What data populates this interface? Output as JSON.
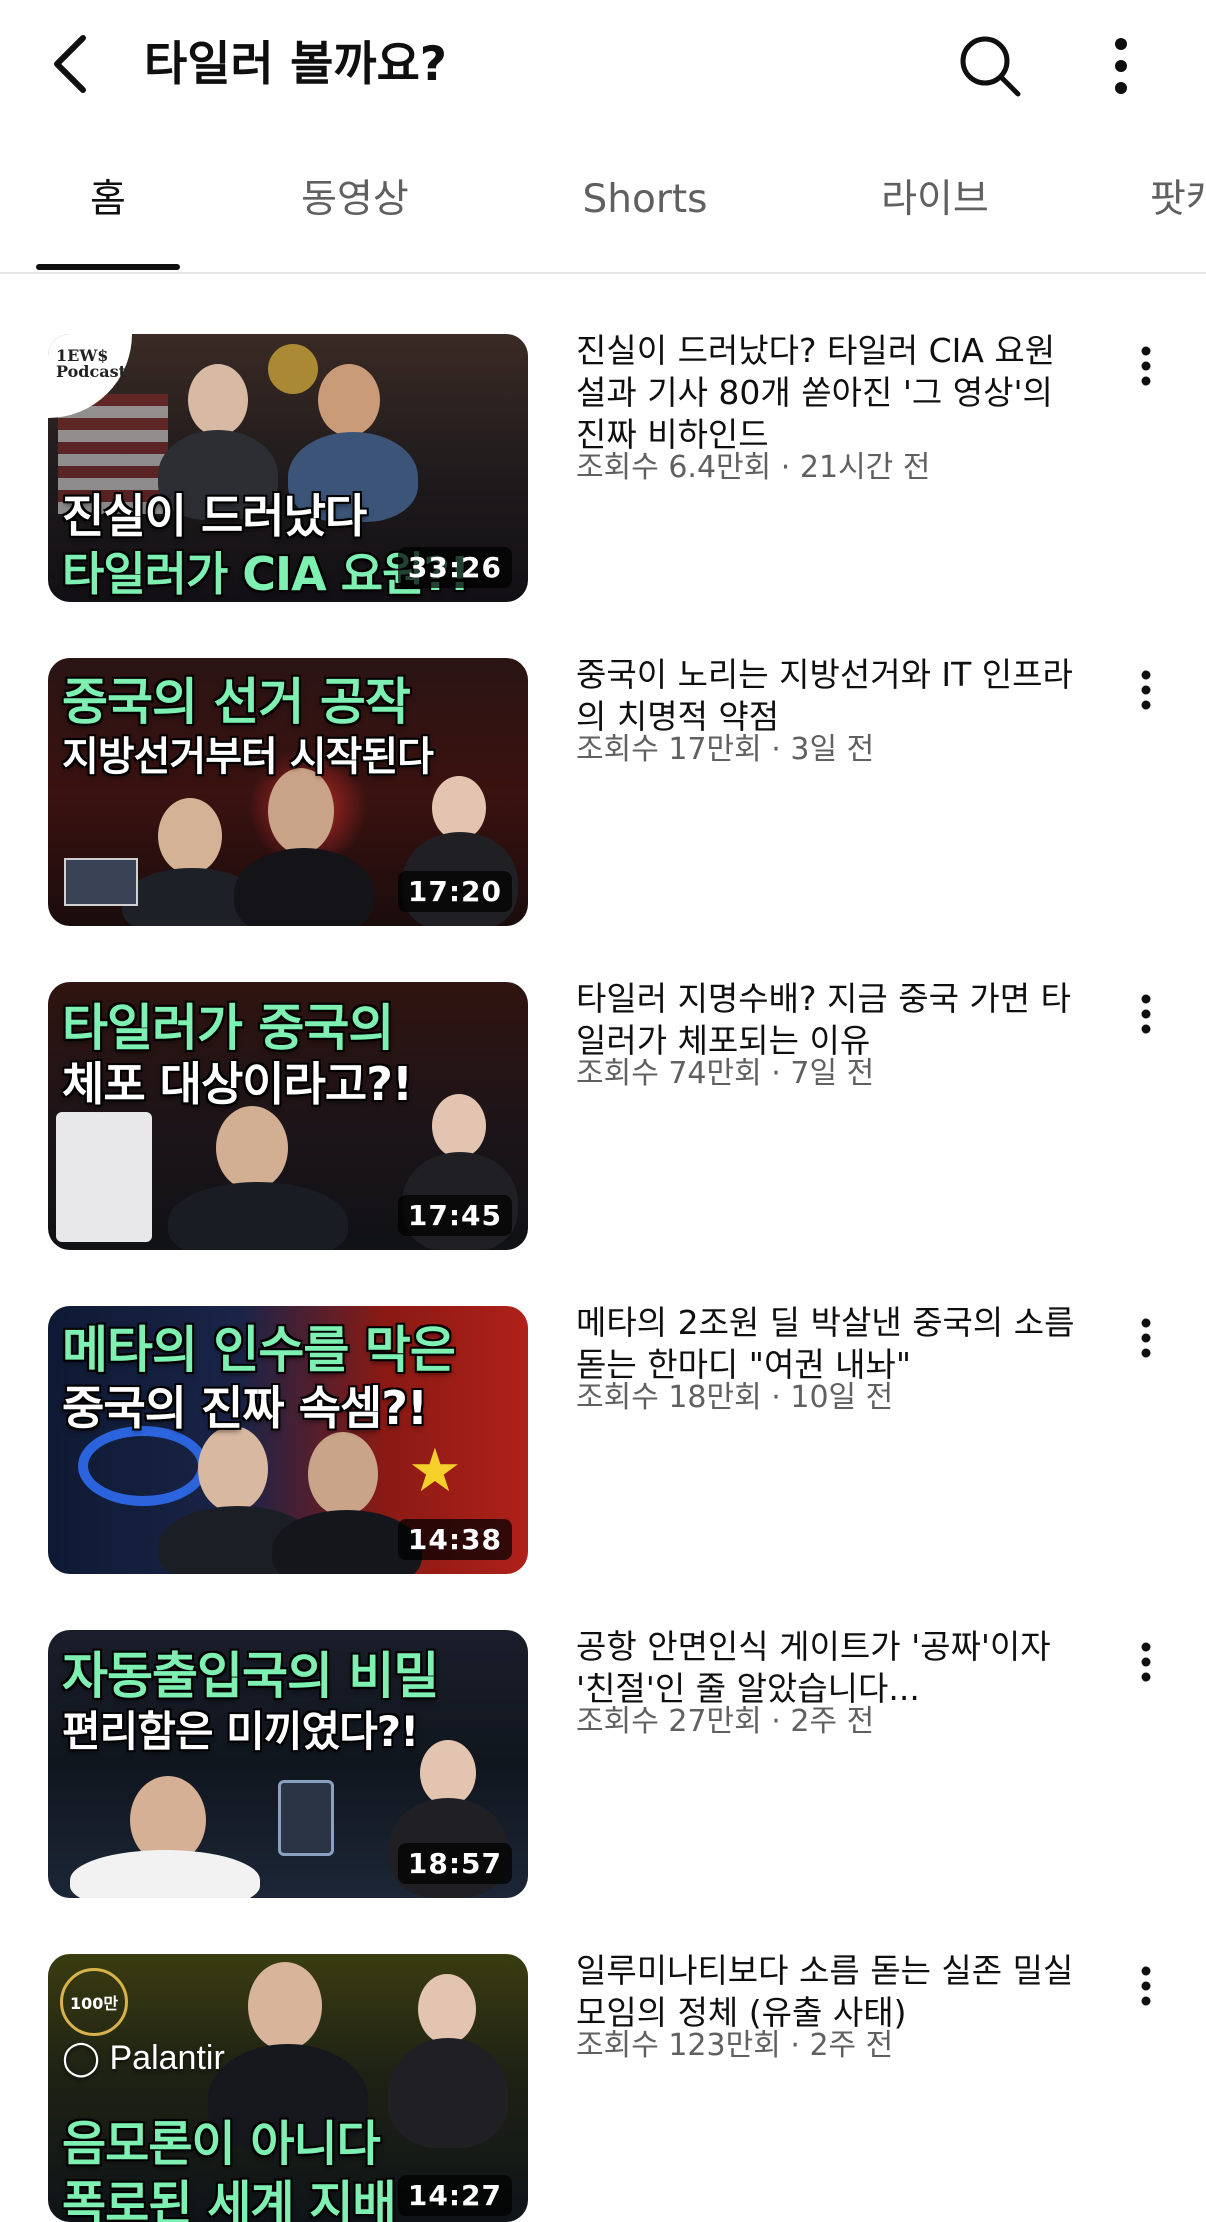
{
  "header": {
    "title": "타일러 볼까요?",
    "back_icon": "back-arrow-icon",
    "search_icon": "search-icon",
    "more_icon": "more-vert-icon"
  },
  "tabs": [
    {
      "label": "홈",
      "active": true
    },
    {
      "label": "동영상",
      "active": false
    },
    {
      "label": "Shorts",
      "active": false
    },
    {
      "label": "라이브",
      "active": false
    },
    {
      "label": "팟캐",
      "active": false
    }
  ],
  "videos": [
    {
      "title": "진실이 드러났다? 타일러 CIA 요원설과 기사 80개 쏟아진 '그 영상'의 진짜 비하인드",
      "views": "조회수 6.4만회",
      "age": "21시간 전",
      "duration": "33:26",
      "thumb_badge": "1EW$ Podcast",
      "thumb_lines": [
        "진실이 드러났다",
        "타일러가 CIA 요원?!"
      ]
    },
    {
      "title": "중국이 노리는 지방선거와 IT 인프라의 치명적 약점",
      "views": "조회수 17만회",
      "age": "3일 전",
      "duration": "17:20",
      "thumb_lines": [
        "중국의 선거 공작",
        "지방선거부터 시작된다"
      ]
    },
    {
      "title": "타일러 지명수배? 지금 중국 가면 타일러가 체포되는 이유",
      "views": "조회수 74만회",
      "age": "7일 전",
      "duration": "17:45",
      "thumb_lines": [
        "타일러가 중국의",
        "체포 대상이라고?!"
      ]
    },
    {
      "title": "메타의 2조원 딜 박살낸 중국의 소름돋는 한마디 \"여권 내놔\"",
      "views": "조회수 18만회",
      "age": "10일 전",
      "duration": "14:38",
      "thumb_lines": [
        "메타의 인수를 막은",
        "중국의 진짜 속셈?!"
      ]
    },
    {
      "title": "공항 안면인식 게이트가 '공짜'이자 '친절'인 줄 알았습니다...",
      "views": "조회수 27만회",
      "age": "2주 전",
      "duration": "18:57",
      "thumb_lines": [
        "자동출입국의 비밀",
        "편리함은 미끼였다?!"
      ]
    },
    {
      "title": "일루미나티보다 소름 돋는 실존 밀실 모임의 정체 (유출 사태)",
      "views": "조회수 123만회",
      "age": "2주 전",
      "duration": "14:27",
      "thumb_badge": "100만",
      "thumb_brand": "Palantir",
      "thumb_lines": [
        "음모론이 아니다",
        "폭로된 세계 지배"
      ]
    }
  ],
  "meta_separator": "·",
  "colors": {
    "accent_text": "#0f0f0f",
    "secondary_text": "#606060",
    "thumb_green": "#7df0b2"
  }
}
